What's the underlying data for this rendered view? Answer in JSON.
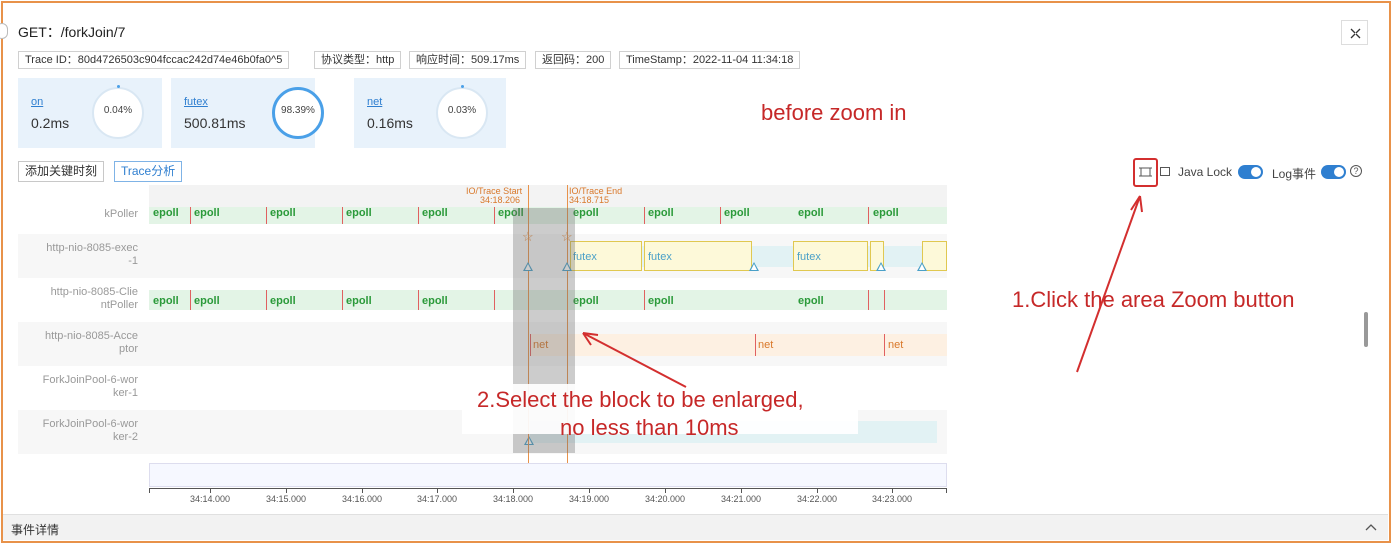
{
  "header": {
    "title": "GET：/forkJoin/7"
  },
  "tags": [
    "Trace ID：80d4726503c904fccac242d74e46b0fa0^5",
    "协议类型：http",
    "响应时间：509.17ms",
    "返回码：200",
    "TimeStamp：2022-11-04 11:34:18"
  ],
  "cards": [
    {
      "name": "on",
      "value": "0.2ms",
      "percent": "0.04%"
    },
    {
      "name": "futex",
      "value": "500.81ms",
      "percent": "98.39%"
    },
    {
      "name": "net",
      "value": "0.16ms",
      "percent": "0.03%"
    }
  ],
  "toolbar": {
    "add_key_time": "添加关键时刻",
    "trace_analysis": "Trace分析",
    "java_lock": "Java Lock",
    "log_event": "Log事件",
    "help": "?"
  },
  "annotations": {
    "before": "before zoom in",
    "step1": "1.Click the area Zoom button",
    "step2_line1": "2.Select the block to be enlarged,",
    "step2_line2": "no less than 10ms"
  },
  "trace_markers": {
    "start_label": "IO/Trace Start",
    "start_time": "34:18.206",
    "end_label": "IO/Trace End",
    "end_time": "34:18.715"
  },
  "rows": [
    {
      "label": "kPoller"
    },
    {
      "label": "http-nio-8085-exec\n-1"
    },
    {
      "label": "http-nio-8085-Clie\nntPoller"
    },
    {
      "label": "http-nio-8085-Acce\nptor"
    },
    {
      "label": "ForkJoinPool-6-wor\nker-1"
    },
    {
      "label": "ForkJoinPool-6-wor\nker-2"
    }
  ],
  "events": {
    "epoll": "epoll",
    "futex": "futex",
    "net": "net"
  },
  "axis_ticks": [
    "34:14.000",
    "34:15.000",
    "34:16.000",
    "34:17.000",
    "34:18.000",
    "34:19.000",
    "34:20.000",
    "34:21.000",
    "34:22.000",
    "34:23.000"
  ],
  "bottom_panel": {
    "title": "事件详情"
  }
}
